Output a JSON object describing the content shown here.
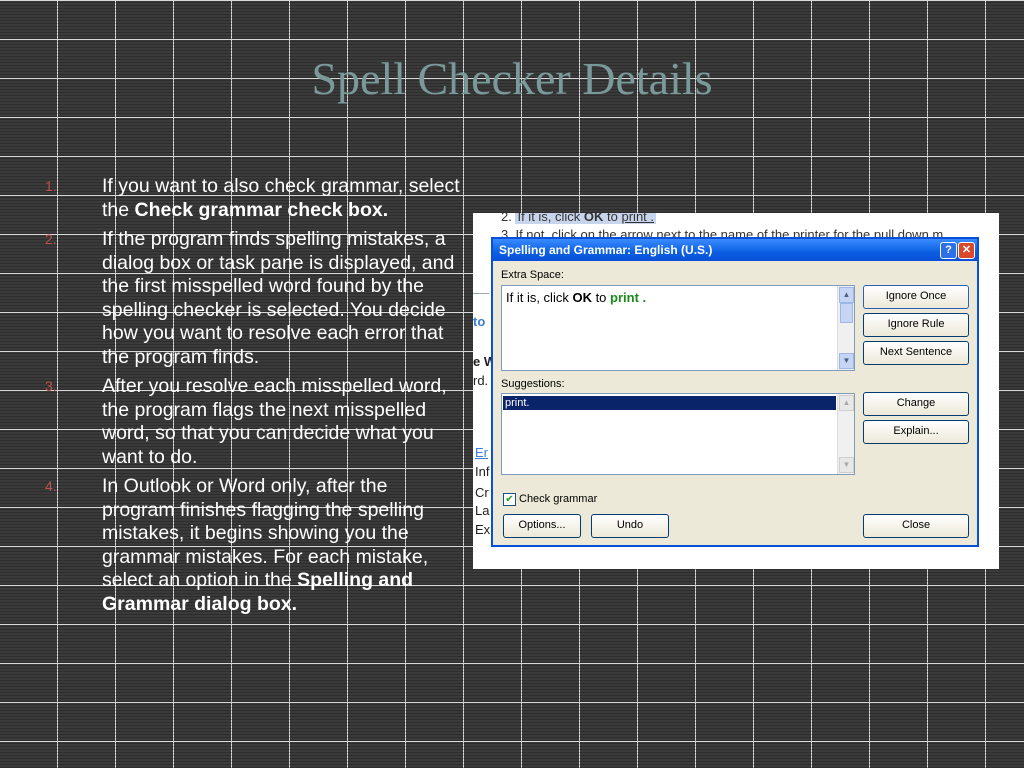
{
  "slide": {
    "title": "Spell Checker Details",
    "steps": [
      {
        "num": "1.",
        "text": "If you want to also check grammar, select the ",
        "bold": "Check grammar check box."
      },
      {
        "num": "2.",
        "text": "If the program finds spelling mistakes, a dialog box or task pane is displayed, and the first misspelled word found by the spelling checker is selected. You decide how you want to resolve each error that the program finds.",
        "bold": ""
      },
      {
        "num": "3.",
        "text": "After you resolve each misspelled word, the program flags the next misspelled word, so that you can decide what you want to do.",
        "bold": ""
      },
      {
        "num": "4.",
        "text": "In Outlook or Word only, after the program finishes flagging the spelling mistakes, it begins showing you the grammar mistakes. For each mistake, select an option in the ",
        "bold": "Spelling and Grammar dialog box."
      }
    ]
  },
  "background_doc": {
    "line1_prefix": "2.",
    "line1_text": "If it is, click ",
    "line1_bold": "OK",
    "line1_after": " to ",
    "line1_link": "print .",
    "line2_prefix": "3.",
    "line2_text": "If not, click on the arrow next to the name of the printer for the pull down m",
    "frag_to": "to",
    "frag_ew": "e W",
    "frag_rd": "rd.",
    "frag_er": "Er",
    "frag_inf": "Inf",
    "frag_cr": "Cr",
    "frag_la": "La",
    "frag_ex": "Ex"
  },
  "dialog": {
    "title": "Spelling and Grammar: English (U.S.)",
    "help_label": "?",
    "close_label": "✕",
    "extra_space_label": "Extra Space:",
    "sentence_text_before": "If it is, click ",
    "sentence_bold": "OK",
    "sentence_after": " to ",
    "sentence_green": "print .",
    "suggestions_label": "Suggestions:",
    "suggestion_selected": "print.",
    "check_grammar_label": "Check grammar",
    "buttons": {
      "ignore_once": "Ignore Once",
      "ignore_rule": "Ignore Rule",
      "next_sentence": "Next Sentence",
      "change": "Change",
      "explain": "Explain...",
      "options": "Options...",
      "undo": "Undo",
      "close": "Close"
    }
  }
}
